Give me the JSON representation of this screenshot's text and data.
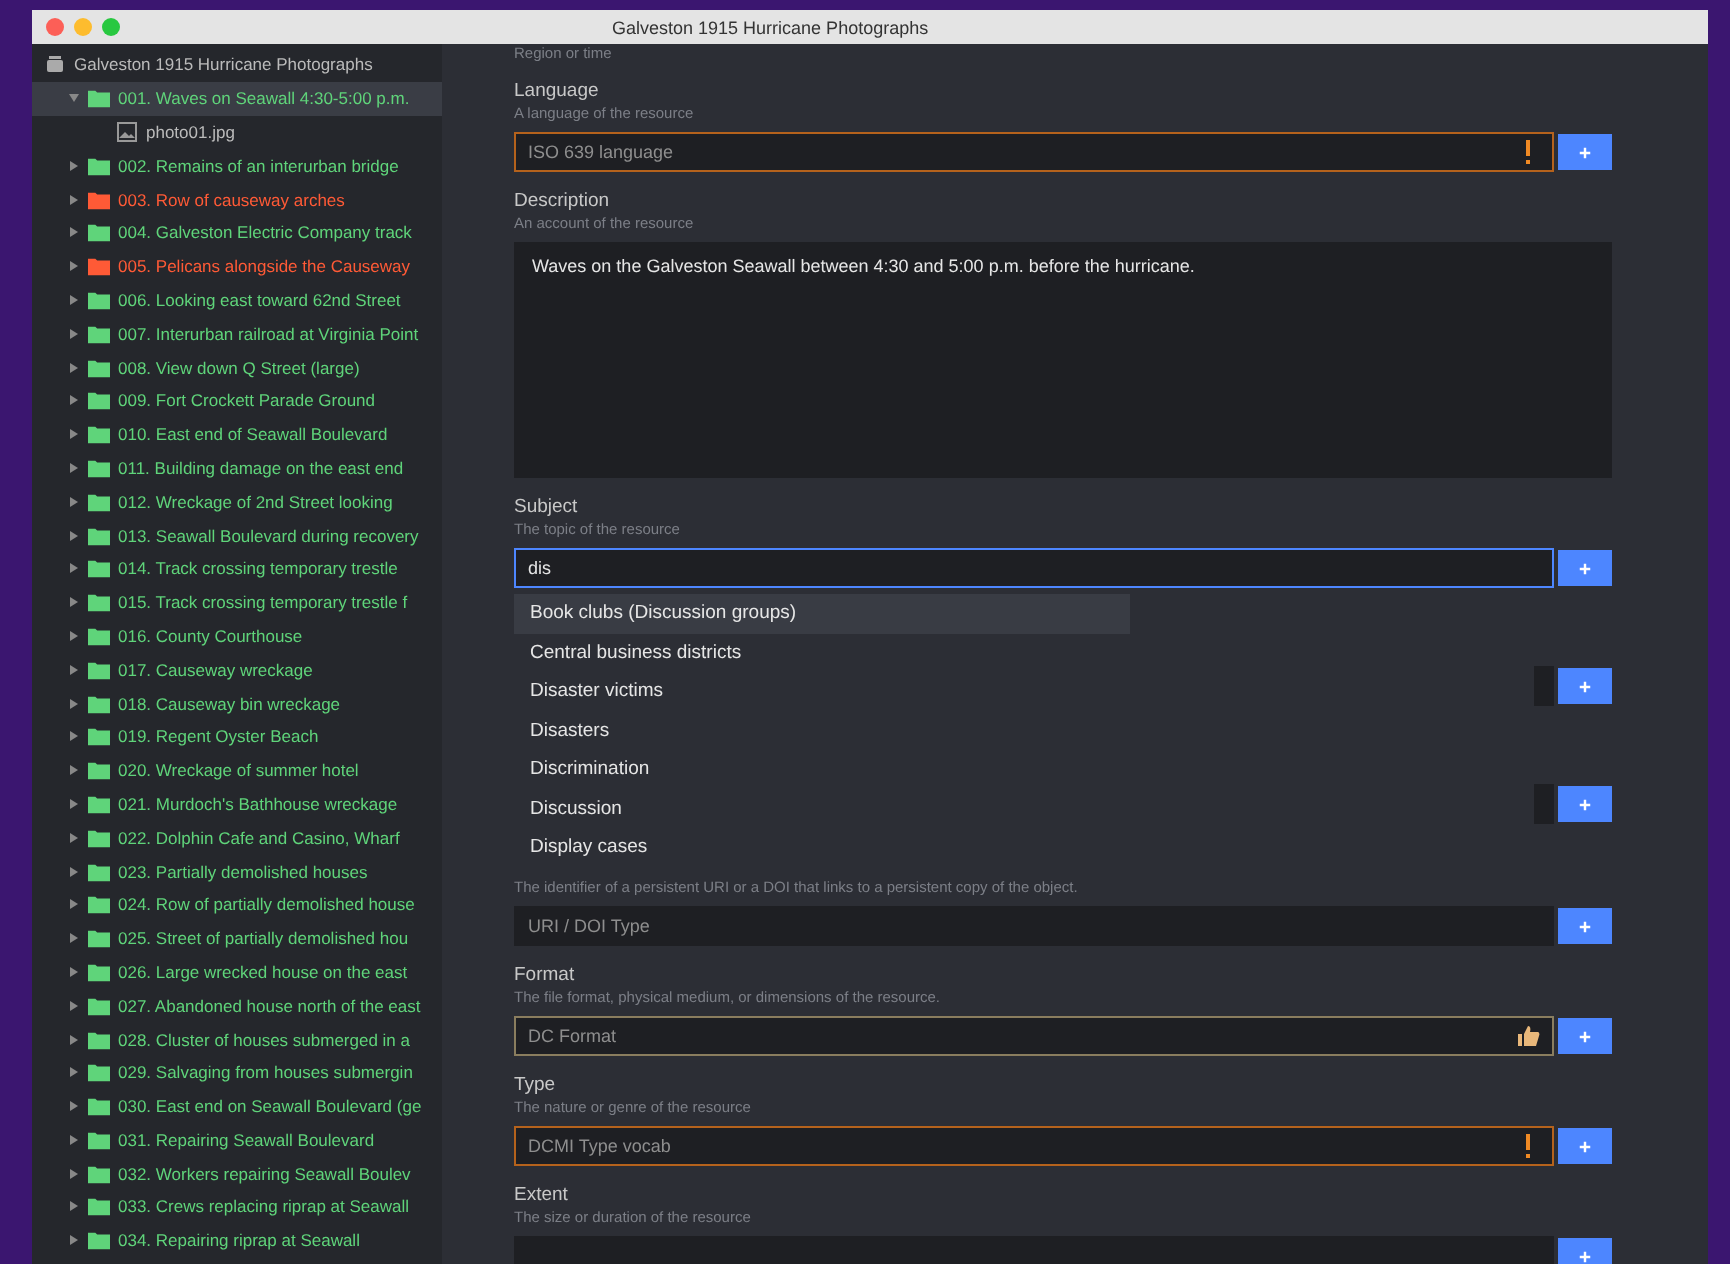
{
  "window": {
    "title": "Galveston 1915 Hurricane Photographs"
  },
  "sidebar": {
    "root": "Galveston 1915 Hurricane Photographs",
    "items": [
      {
        "label": "001. Waves on Seawall 4:30-5:00 p.m.",
        "color": "#5fd47a",
        "selected": true,
        "expanded": true,
        "children": [
          {
            "label": "photo01.jpg"
          }
        ]
      },
      {
        "label": "002. Remains of an interurban bridge",
        "color": "#5fd47a",
        "selected": false,
        "expanded": false
      },
      {
        "label": "003. Row of causeway arches",
        "color": "#ff5a36",
        "selected": false,
        "expanded": false
      },
      {
        "label": "004. Galveston Electric Company track",
        "color": "#5fd47a",
        "selected": false,
        "expanded": false
      },
      {
        "label": "005. Pelicans alongside the Causeway",
        "color": "#ff5a36",
        "selected": false,
        "expanded": false
      },
      {
        "label": "006. Looking east toward 62nd Street",
        "color": "#5fd47a",
        "selected": false,
        "expanded": false
      },
      {
        "label": "007. Interurban railroad at Virginia Point",
        "color": "#5fd47a",
        "selected": false,
        "expanded": false
      },
      {
        "label": "008. View down Q Street (large)",
        "color": "#5fd47a",
        "selected": false,
        "expanded": false
      },
      {
        "label": "009. Fort Crockett Parade Ground",
        "color": "#5fd47a",
        "selected": false,
        "expanded": false
      },
      {
        "label": "010. East end of Seawall Boulevard",
        "color": "#5fd47a",
        "selected": false,
        "expanded": false
      },
      {
        "label": "011. Building damage on the east end",
        "color": "#5fd47a",
        "selected": false,
        "expanded": false
      },
      {
        "label": "012. Wreckage of 2nd Street looking",
        "color": "#5fd47a",
        "selected": false,
        "expanded": false
      },
      {
        "label": "013. Seawall Boulevard during recovery",
        "color": "#5fd47a",
        "selected": false,
        "expanded": false
      },
      {
        "label": "014. Track crossing temporary trestle",
        "color": "#5fd47a",
        "selected": false,
        "expanded": false
      },
      {
        "label": "015. Track crossing temporary trestle f",
        "color": "#5fd47a",
        "selected": false,
        "expanded": false
      },
      {
        "label": "016. County Courthouse",
        "color": "#5fd47a",
        "selected": false,
        "expanded": false
      },
      {
        "label": "017. Causeway wreckage",
        "color": "#5fd47a",
        "selected": false,
        "expanded": false
      },
      {
        "label": "018. Causeway bin wreckage",
        "color": "#5fd47a",
        "selected": false,
        "expanded": false
      },
      {
        "label": "019. Regent Oyster Beach",
        "color": "#5fd47a",
        "selected": false,
        "expanded": false
      },
      {
        "label": "020. Wreckage of summer hotel",
        "color": "#5fd47a",
        "selected": false,
        "expanded": false
      },
      {
        "label": "021. Murdoch's Bathhouse wreckage",
        "color": "#5fd47a",
        "selected": false,
        "expanded": false
      },
      {
        "label": "022. Dolphin Cafe and Casino, Wharf",
        "color": "#5fd47a",
        "selected": false,
        "expanded": false
      },
      {
        "label": "023. Partially demolished houses",
        "color": "#5fd47a",
        "selected": false,
        "expanded": false
      },
      {
        "label": "024. Row of partially demolished house",
        "color": "#5fd47a",
        "selected": false,
        "expanded": false
      },
      {
        "label": "025. Street of partially demolished hou",
        "color": "#5fd47a",
        "selected": false,
        "expanded": false
      },
      {
        "label": "026. Large wrecked house on the east",
        "color": "#5fd47a",
        "selected": false,
        "expanded": false
      },
      {
        "label": "027. Abandoned house north of the east",
        "color": "#5fd47a",
        "selected": false,
        "expanded": false
      },
      {
        "label": "028. Cluster of houses submerged in a",
        "color": "#5fd47a",
        "selected": false,
        "expanded": false
      },
      {
        "label": "029. Salvaging from houses submergin",
        "color": "#5fd47a",
        "selected": false,
        "expanded": false
      },
      {
        "label": "030. East end on Seawall Boulevard (ge",
        "color": "#5fd47a",
        "selected": false,
        "expanded": false
      },
      {
        "label": "031. Repairing Seawall Boulevard",
        "color": "#5fd47a",
        "selected": false,
        "expanded": false
      },
      {
        "label": "032. Workers repairing Seawall Boulev",
        "color": "#5fd47a",
        "selected": false,
        "expanded": false
      },
      {
        "label": "033. Crews replacing riprap at Seawall",
        "color": "#5fd47a",
        "selected": false,
        "expanded": false
      },
      {
        "label": "034. Repairing riprap at Seawall",
        "color": "#5fd47a",
        "selected": false,
        "expanded": false
      }
    ]
  },
  "top_hint": "Region or time",
  "fields": [
    {
      "kind": "text",
      "label": "Language",
      "hint": "A language of the resource",
      "placeholder": "ISO 639 language",
      "focused": false,
      "warning": true,
      "approved": false
    },
    {
      "kind": "textarea",
      "label": "Description",
      "hint": "An account of the resource",
      "value": "Waves on the Galveston Seawall between 4:30 and 5:00 p.m. before the hurricane."
    },
    {
      "kind": "text",
      "label": "Subject",
      "hint": "The topic of the resource",
      "value": "dis",
      "focused": true,
      "warning": false,
      "approved": false,
      "suggestions": [
        {
          "label": "Book clubs (Discussion groups)",
          "selected": true
        },
        {
          "label": "Central business districts",
          "selected": false
        },
        {
          "label": "Disaster victims",
          "selected": false
        },
        {
          "label": "Disasters",
          "selected": false
        },
        {
          "label": "Discrimination",
          "selected": false
        },
        {
          "label": "Discussion",
          "selected": false
        },
        {
          "label": "Display cases",
          "selected": false
        }
      ]
    },
    {
      "kind": "covered"
    },
    {
      "kind": "covered"
    },
    {
      "kind": "text",
      "hint": "The identifier of a persistent URI or a DOI that links to a persistent copy of the object.",
      "placeholder": "URI / DOI Type",
      "focused": false,
      "warning": false,
      "approved": false
    },
    {
      "kind": "text",
      "label": "Format",
      "hint": "The file format, physical medium, or dimensions of the resource.",
      "placeholder": "DC Format",
      "focused": false,
      "warning": false,
      "approved": true
    },
    {
      "kind": "text",
      "label": "Type",
      "hint": "The nature or genre of the resource",
      "placeholder": "DCMI Type vocab",
      "focused": false,
      "warning": true,
      "approved": false
    },
    {
      "kind": "text",
      "label": "Extent",
      "hint": "The size or duration of the resource",
      "focused": false,
      "warning": false,
      "approved": false
    }
  ]
}
